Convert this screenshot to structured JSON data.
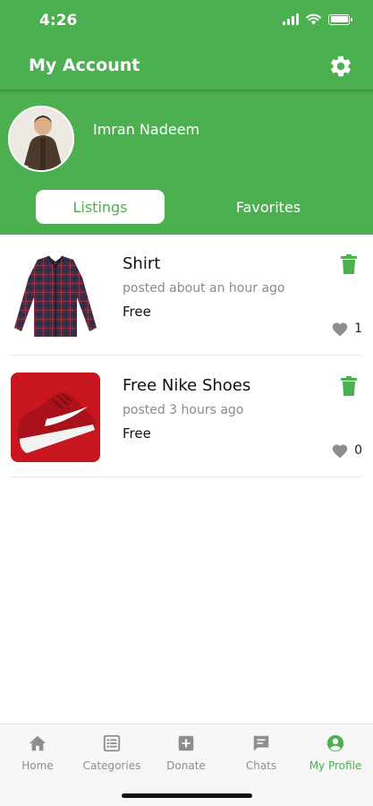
{
  "status_bar": {
    "time": "4:26"
  },
  "header": {
    "title": "My Account",
    "settings_icon": "gear-icon"
  },
  "profile": {
    "name": "Imran Nadeem"
  },
  "tabs": [
    {
      "label": "Listings",
      "active": true
    },
    {
      "label": "Favorites",
      "active": false
    }
  ],
  "listings": [
    {
      "title": "Shirt",
      "posted": "posted about an hour ago",
      "price": "Free",
      "likes": "1",
      "image": "plaid-shirt"
    },
    {
      "title": "Free Nike Shoes",
      "posted": "posted 3 hours ago",
      "price": "Free",
      "likes": "0",
      "image": "red-sneaker"
    }
  ],
  "bottom_nav": [
    {
      "label": "Home",
      "icon": "home-icon",
      "active": false
    },
    {
      "label": "Categories",
      "icon": "categories-icon",
      "active": false
    },
    {
      "label": "Donate",
      "icon": "donate-icon",
      "active": false
    },
    {
      "label": "Chats",
      "icon": "chat-icon",
      "active": false
    },
    {
      "label": "My Profile",
      "icon": "profile-icon",
      "active": true
    }
  ],
  "colors": {
    "primary": "#4caf50",
    "inactive": "#8e8e8e",
    "background": "#ffffff"
  }
}
